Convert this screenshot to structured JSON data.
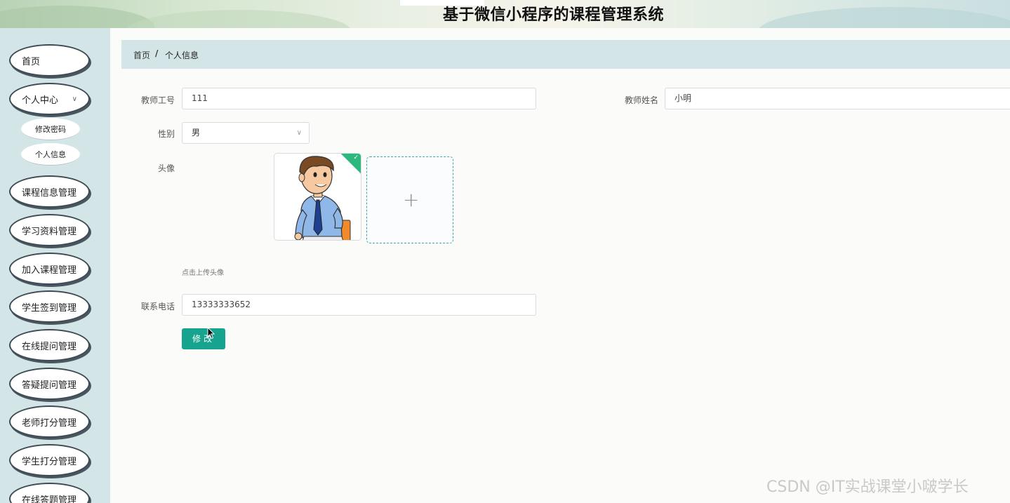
{
  "header": {
    "title": "基于微信小程序的课程管理系统"
  },
  "sidebar": {
    "items": [
      {
        "label": "首页"
      },
      {
        "label": "个人中心"
      },
      {
        "label": "课程信息管理"
      },
      {
        "label": "学习资料管理"
      },
      {
        "label": "加入课程管理"
      },
      {
        "label": "学生签到管理"
      },
      {
        "label": "在线提问管理"
      },
      {
        "label": "答疑提问管理"
      },
      {
        "label": "老师打分管理"
      },
      {
        "label": "学生打分管理"
      },
      {
        "label": "在线答题管理"
      }
    ],
    "sub_items": [
      {
        "label": "修改密码"
      },
      {
        "label": "个人信息"
      }
    ]
  },
  "breadcrumb": {
    "home": "首页",
    "separator": "/",
    "current": "个人信息"
  },
  "form": {
    "teacher_id_label": "教师工号",
    "teacher_id_value": "111",
    "teacher_name_label": "教师姓名",
    "teacher_name_value": "小明",
    "gender_label": "性别",
    "gender_value": "男",
    "avatar_label": "头像",
    "avatar_hint": "点击上传头像",
    "phone_label": "联系电话",
    "phone_value": "13333333652",
    "submit_label": "修改"
  },
  "watermark": "CSDN @IT实战课堂小啵学长",
  "colors": {
    "accent": "#17a48e",
    "sidebar_bg": "#d3e5e6",
    "upload_border": "#3aa7b3",
    "success_badge": "#2db87d"
  }
}
